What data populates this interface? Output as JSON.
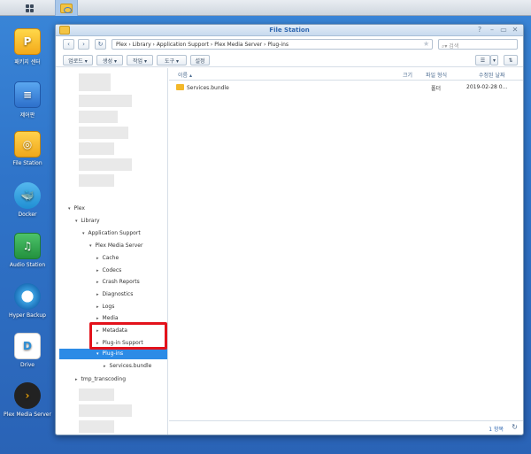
{
  "taskbar": {
    "main_menu_icon": "grid-icon",
    "file_station_icon": "folder-icon"
  },
  "desktop": [
    {
      "label": "패키지 센터",
      "icon": "package-center-icon"
    },
    {
      "label": "제어판",
      "icon": "control-panel-icon"
    },
    {
      "label": "File Station",
      "icon": "file-station-icon"
    },
    {
      "label": "Docker",
      "icon": "docker-icon"
    },
    {
      "label": "Audio Station",
      "icon": "audio-station-icon"
    },
    {
      "label": "Hyper Backup",
      "icon": "hyper-backup-icon"
    },
    {
      "label": "Drive",
      "icon": "drive-icon"
    },
    {
      "label": "Plex Media Server",
      "icon": "plex-icon"
    }
  ],
  "window": {
    "title": "File Station",
    "path": "Plex  ›  Library  ›  Application Support  ›  Plex Media Server  ›  Plug-ins",
    "search_placeholder": "검색",
    "toolbar": {
      "upload": "업로드 ▾",
      "create": "생성 ▾",
      "action": "작업 ▾",
      "tools": "도구 ▾",
      "settings": "설정"
    }
  },
  "tree": {
    "plex": "Plex",
    "library": "Library",
    "app_support": "Application Support",
    "pms": "Plex Media Server",
    "cache": "Cache",
    "codecs": "Codecs",
    "crash": "Crash Reports",
    "diagnostics": "Diagnostics",
    "logs": "Logs",
    "media": "Media",
    "metadata": "Metadata",
    "plugin_support": "Plug-in Support",
    "plugins": "Plug-ins",
    "services": "Services.bundle",
    "tmp": "tmp_transcoding"
  },
  "list": {
    "col_name": "이름 ▴",
    "col_size": "크기",
    "col_type": "파일 형식",
    "col_modified": "수정된 날짜",
    "rows": [
      {
        "name": "Services.bundle",
        "size": "",
        "type": "폴더",
        "modified": "2019-02-28 0..."
      }
    ],
    "count": "1 항목"
  }
}
